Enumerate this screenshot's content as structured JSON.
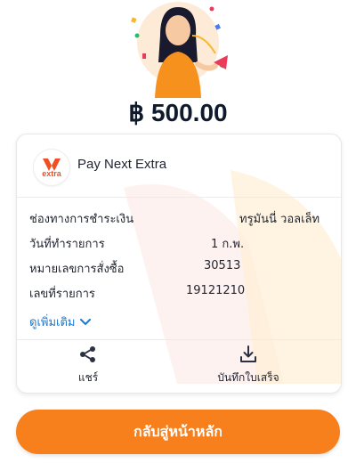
{
  "amount": "฿ 500.00",
  "merchant": {
    "name": "Pay Next Extra",
    "logo_text": "extra"
  },
  "details": [
    {
      "label": "ช่องทางการชำระเงิน",
      "value": "ทรูมันนี่ วอลเล็ท"
    },
    {
      "label": "วันที่ทำรายการ",
      "value": "1 ก.พ."
    },
    {
      "label": "หมายเลขการสั่งซื้อ",
      "value": "30513"
    },
    {
      "label": "เลขที่รายการ",
      "value": "19121210"
    }
  ],
  "more_label": "ดูเพิ่มเติม",
  "actions": {
    "share_label": "แชร์",
    "save_label": "บันทึกใบเสร็จ"
  },
  "home_button_label": "กลับสู่หน้าหลัก",
  "colors": {
    "accent": "#f77f1c",
    "link": "#1f78d1",
    "logo_red": "#f04e23"
  }
}
